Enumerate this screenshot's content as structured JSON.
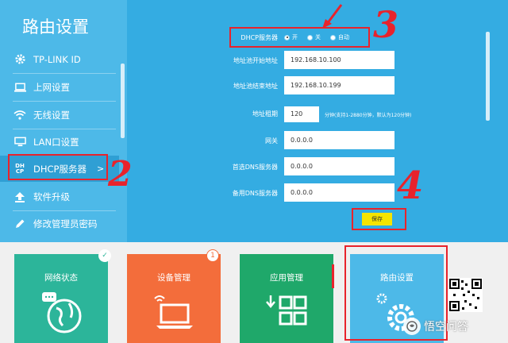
{
  "sidebar": {
    "title": "路由设置",
    "items": [
      {
        "label": "TP-LINK ID",
        "icon": "gear-icon"
      },
      {
        "label": "上网设置",
        "icon": "laptop-icon"
      },
      {
        "label": "无线设置",
        "icon": "wifi-icon"
      },
      {
        "label": "LAN口设置",
        "icon": "monitor-icon"
      },
      {
        "label": "DHCP服务器",
        "icon": "dhcp-icon",
        "active": true,
        "glyph_top": "DH",
        "glyph_bottom": "CP"
      },
      {
        "label": "软件升级",
        "icon": "upload-arrow-icon"
      },
      {
        "label": "修改管理员密码",
        "icon": "pencil-icon"
      }
    ]
  },
  "form": {
    "dhcp_label": "DHCP服务器",
    "radio_options": [
      "开",
      "关",
      "自动"
    ],
    "selected": "开",
    "start_label": "地址池开始地址",
    "start_value": "192.168.10.100",
    "end_label": "地址池结束地址",
    "end_value": "192.168.10.199",
    "lease_label": "地址租期",
    "lease_value": "120",
    "lease_hint": "分钟(支持1-2880分钟，默认为120分钟)",
    "gateway_label": "网关",
    "gateway_value": "0.0.0.0",
    "dns1_label": "首选DNS服务器",
    "dns1_value": "0.0.0.0",
    "dns2_label": "备用DNS服务器",
    "dns2_value": "0.0.0.0",
    "save_label": "保存"
  },
  "annotations": {
    "n2": "2",
    "n3": "3",
    "n4": "4",
    "n1": "1"
  },
  "tiles": [
    {
      "label": "网络状态",
      "color": "#2cb59a",
      "badge": "✓"
    },
    {
      "label": "设备管理",
      "color": "#f36d3b",
      "badge": "1"
    },
    {
      "label": "应用管理",
      "color": "#1fa86a"
    },
    {
      "label": "路由设置",
      "color": "#4db9e8"
    }
  ],
  "watermark": {
    "text": "悟空问答"
  },
  "colors": {
    "sidebar": "#4db9e8",
    "main": "#34ace2",
    "annotation": "#e8232c",
    "save": "#f5e400"
  }
}
